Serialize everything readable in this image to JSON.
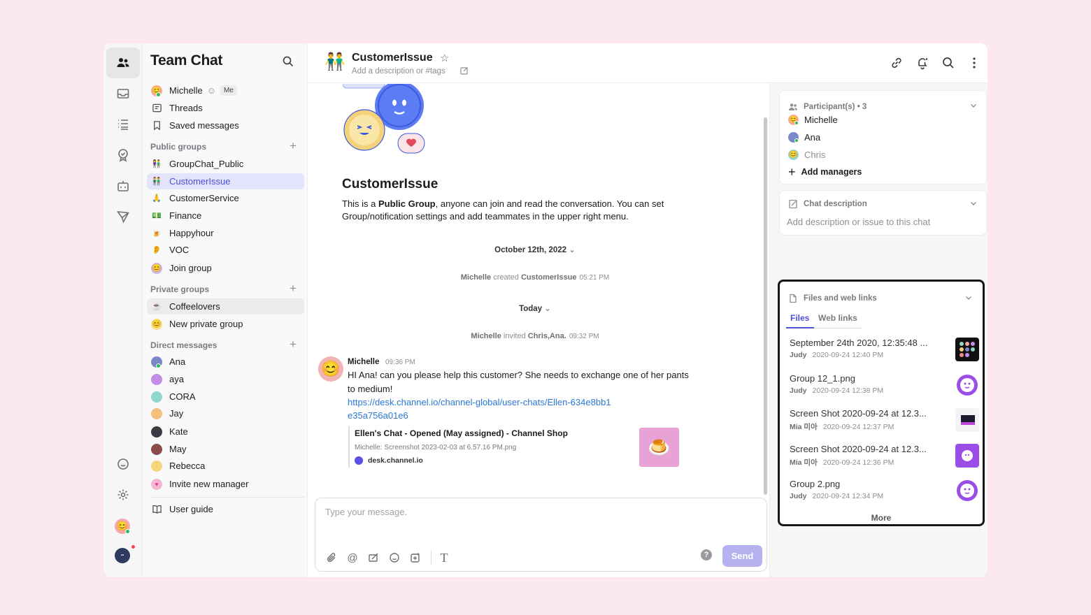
{
  "sidebar": {
    "title": "Team Chat",
    "me": {
      "name": "Michelle",
      "badge": "Me"
    },
    "top_items": [
      {
        "label": "Threads",
        "icon": "threads-icon"
      },
      {
        "label": "Saved messages",
        "icon": "bookmark-icon"
      }
    ],
    "public_groups": {
      "heading": "Public groups",
      "items": [
        {
          "label": "GroupChat_Public",
          "emoji": "👫"
        },
        {
          "label": "CustomerIssue",
          "emoji": "👬"
        },
        {
          "label": "CustomerService",
          "emoji": "🙏"
        },
        {
          "label": "Finance",
          "emoji": "💵"
        },
        {
          "label": "Happyhour",
          "emoji": "🍺"
        },
        {
          "label": "VOC",
          "emoji": "👂"
        },
        {
          "label": "Join group",
          "emoji": "😊"
        }
      ]
    },
    "private_groups": {
      "heading": "Private groups",
      "items": [
        {
          "label": "Coffeelovers",
          "emoji": "☕"
        },
        {
          "label": "New private group",
          "emoji": "😊"
        }
      ]
    },
    "direct_messages": {
      "heading": "Direct messages",
      "items": [
        {
          "label": "Ana"
        },
        {
          "label": "aya"
        },
        {
          "label": "CORA"
        },
        {
          "label": "Jay"
        },
        {
          "label": "Kate"
        },
        {
          "label": "May"
        },
        {
          "label": "Rebecca"
        },
        {
          "label": "Invite new manager"
        }
      ]
    },
    "user_guide": "User guide"
  },
  "header": {
    "emoji": "👬",
    "title": "CustomerIssue",
    "description_placeholder": "Add a description or #tags"
  },
  "welcome": {
    "title": "CustomerIssue",
    "text_before": "This is a ",
    "text_bold": "Public Group",
    "text_after": ", anyone can join and read the conversation. You can set Group/notification settings and add teammates in the upper right menu."
  },
  "timeline": {
    "date1": "October 12th, 2022",
    "sys1": {
      "actor": "Michelle",
      "verb": "created",
      "object": "CustomerIssue",
      "time": "05:21 PM"
    },
    "date2": "Today",
    "sys2": {
      "actor": "Michelle",
      "verb": "invited",
      "object": "Chris,Ana.",
      "time": "09:32 PM"
    }
  },
  "message": {
    "author": "Michelle",
    "time": "09:36 PM",
    "text": "HI Ana! can you please help this customer? She needs to exchange one of her pants to medium!",
    "link": "https://desk.channel.io/channel-global/user-chats/Ellen-634e8bb1e35a756a01e6",
    "preview": {
      "title": "Ellen's Chat - Opened (May assigned) - Channel Shop",
      "subtitle": "Michelle: Screenshot 2023-02-03 at 6.57.16 PM.png",
      "site": "desk.channel.io"
    }
  },
  "composer": {
    "placeholder": "Type your message.",
    "send_label": "Send"
  },
  "right_panel": {
    "participants": {
      "heading": "Participant(s)",
      "count": "• 3",
      "people": [
        "Michelle",
        "Ana",
        "Chris"
      ],
      "add_label": "Add managers"
    },
    "description": {
      "heading": "Chat description",
      "placeholder": "Add description or issue to this chat"
    },
    "files": {
      "heading": "Files and web links",
      "tabs": [
        "Files",
        "Web links"
      ],
      "items": [
        {
          "name": "September 24th 2020, 12:35:48 ...",
          "user": "Judy",
          "time": "2020-09-24 12:40 PM"
        },
        {
          "name": "Group 12_1.png",
          "user": "Judy",
          "time": "2020-09-24 12:38 PM"
        },
        {
          "name": "Screen Shot 2020-09-24 at 12.3...",
          "user": "Mia 미아",
          "time": "2020-09-24 12:37 PM"
        },
        {
          "name": "Screen Shot 2020-09-24 at 12.3...",
          "user": "Mia 미아",
          "time": "2020-09-24 12:36 PM"
        },
        {
          "name": "Group 2.png",
          "user": "Judy",
          "time": "2020-09-24 12:34 PM"
        }
      ],
      "more_label": "More"
    }
  },
  "colors": {
    "accent": "#4c50d6",
    "send_disabled": "#b6b2f0",
    "link": "#2a78d6",
    "online": "#2fb85b"
  }
}
